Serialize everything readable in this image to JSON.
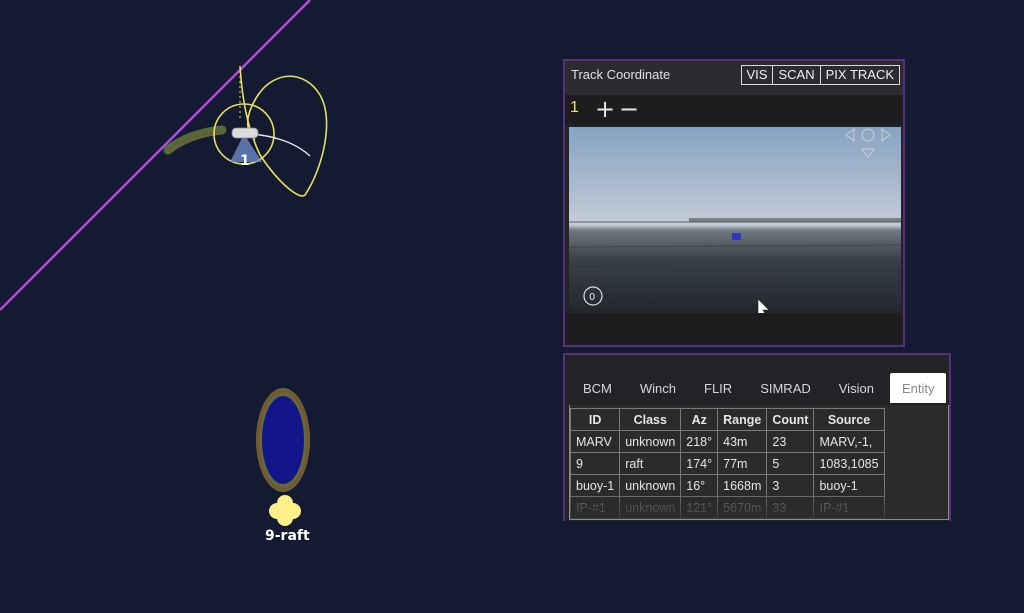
{
  "map": {
    "vessel_label": "1",
    "raft_label": "9-raft"
  },
  "track_panel": {
    "title": "Track Coordinate",
    "modes": [
      "VIS",
      "SCAN",
      "PIX TRACK"
    ],
    "camera_index": "1",
    "zoom_in": "+",
    "zoom_out": "−"
  },
  "data_panel": {
    "tabs": [
      "BCM",
      "Winch",
      "FLIR",
      "SIMRAD",
      "Vision",
      "Entity"
    ],
    "active_tab": "Entity",
    "table": {
      "headers": [
        "ID",
        "Class",
        "Az",
        "Range",
        "Count",
        "Source"
      ],
      "rows": [
        [
          "MARV",
          "unknown",
          "218°",
          "43m",
          "23",
          "MARV,-1,"
        ],
        [
          "9",
          "raft",
          "174°",
          "77m",
          "5",
          "1083,1085"
        ],
        [
          "buoy-1",
          "unknown",
          "16°",
          "1668m",
          "3",
          "buoy-1"
        ],
        [
          "IP-#1",
          "unknown",
          "121°",
          "5670m",
          "33",
          "IP-#1"
        ]
      ]
    }
  },
  "colors": {
    "map_bg": "#131a31",
    "boundary": "#b44be0",
    "track": "#e6e05a",
    "raft_marker": "#fff08a",
    "panel_border": "#5a2f7a"
  }
}
